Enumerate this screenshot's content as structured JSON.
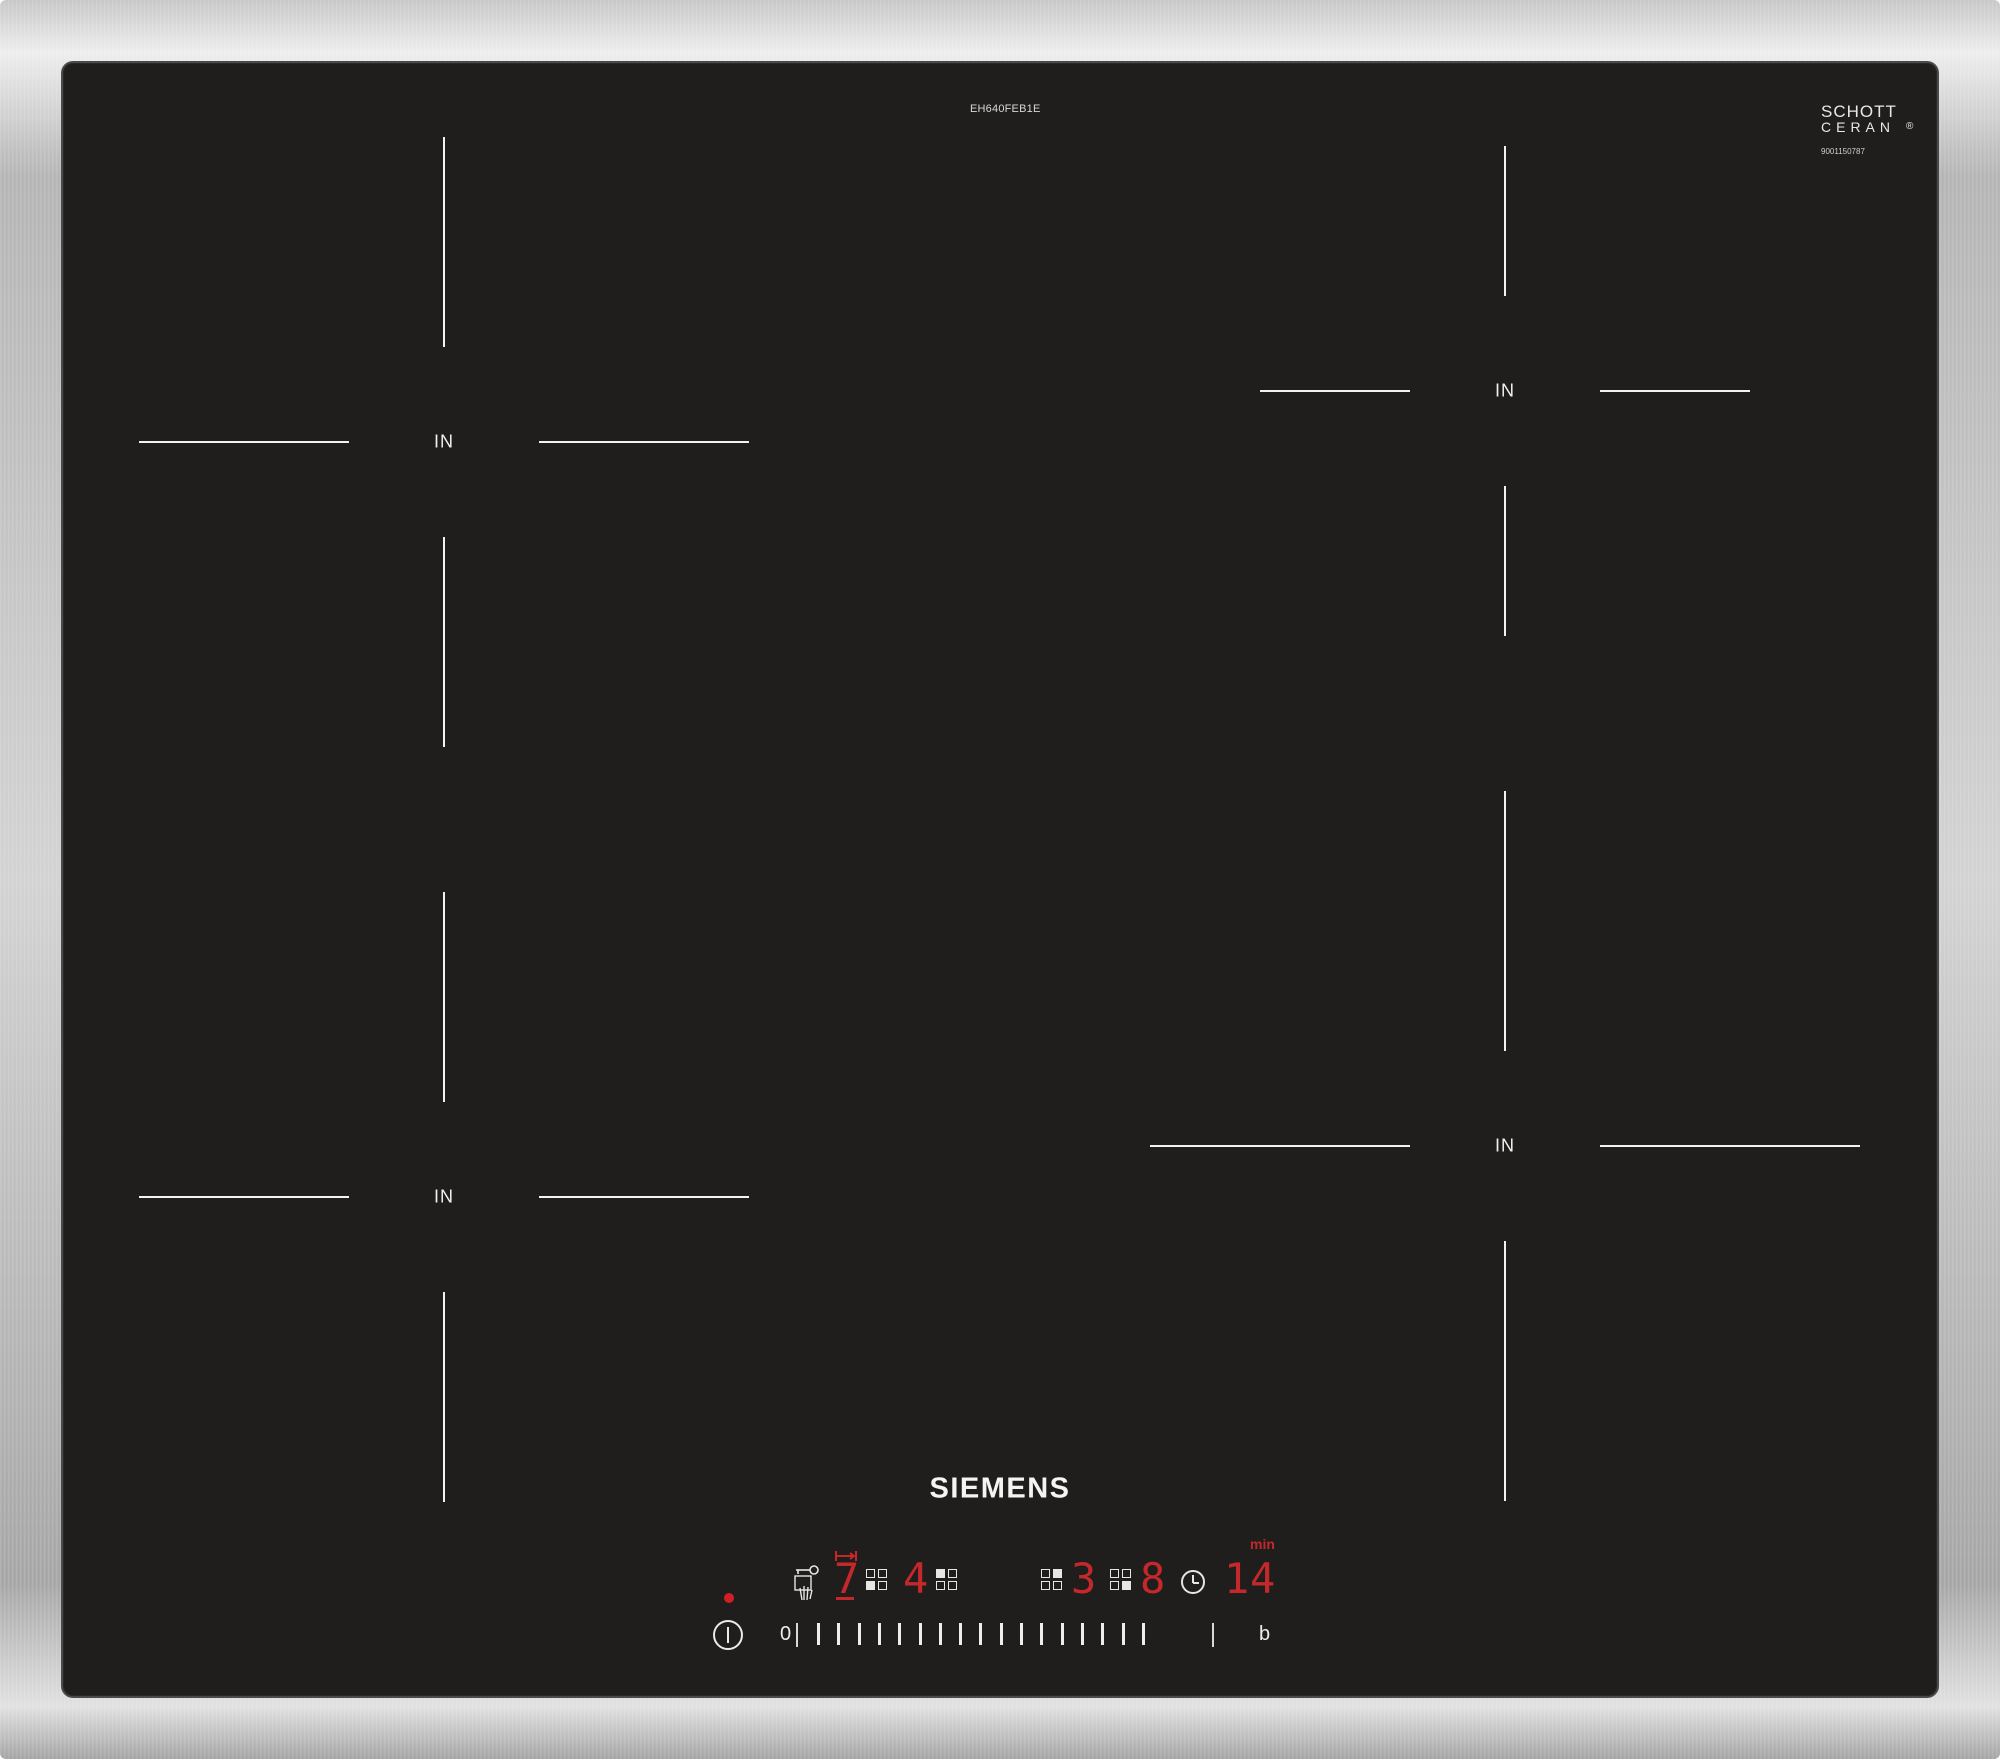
{
  "hob": {
    "model": "EH640FEB1E",
    "brand_top_line1": "SCHOTT",
    "brand_top_line2": "CERAN",
    "brand_top_reg": "®",
    "serial": "9001150787",
    "brand": "SIEMENS"
  },
  "zones": {
    "front_left": {
      "label": "IN"
    },
    "back_left": {
      "label": "IN"
    },
    "back_right": {
      "label": "IN"
    },
    "front_right": {
      "label": "IN"
    }
  },
  "control_panel": {
    "zone1_level": "7",
    "zone2_level": "4",
    "zone3_level": "3",
    "zone4_level": "8",
    "timer_digit1": "1",
    "timer_digit2": "4",
    "timer_unit": "min",
    "slider_min": "0",
    "slider_boost": "b",
    "slider_tick_count": 17,
    "colors": {
      "display_red": "#c5282a",
      "glass": "#1f1e1c",
      "marking": "#f2f2f2"
    },
    "icons": [
      "power-icon",
      "child-lock-icon",
      "clock-icon",
      "zone-indicator-icon",
      "transfer-icon"
    ]
  }
}
